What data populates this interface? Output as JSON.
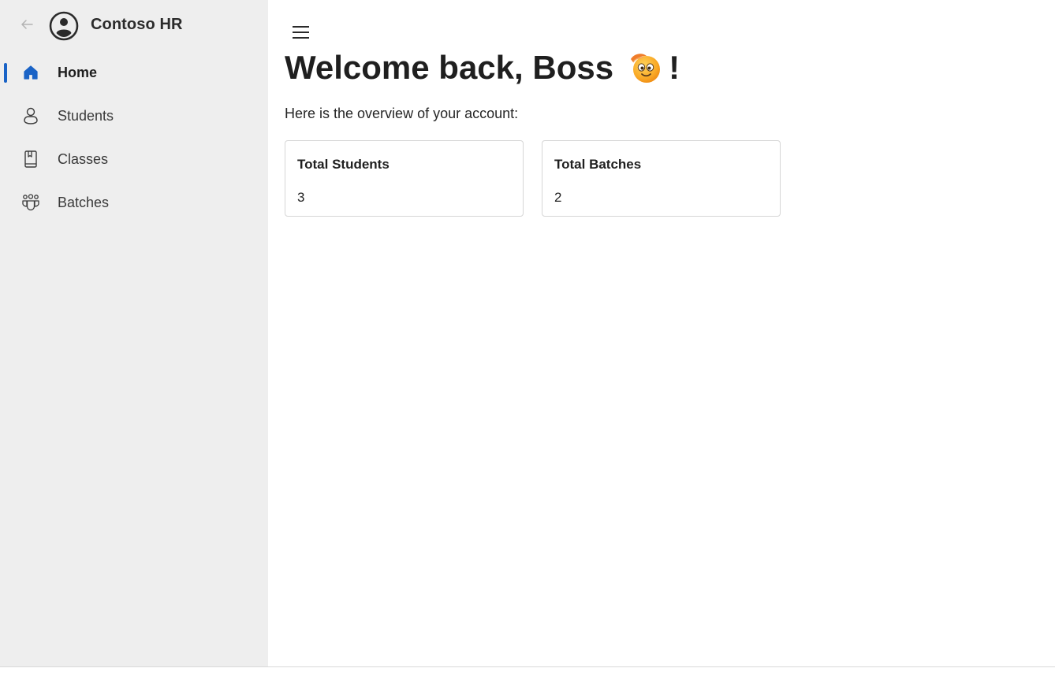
{
  "app": {
    "title": "Contoso HR",
    "accent_color": "#1a63c6"
  },
  "sidebar": {
    "items": [
      {
        "label": "Home",
        "icon": "home-icon",
        "active": true
      },
      {
        "label": "Students",
        "icon": "person-icon",
        "active": false
      },
      {
        "label": "Classes",
        "icon": "book-icon",
        "active": false
      },
      {
        "label": "Batches",
        "icon": "people-team-icon",
        "active": false
      }
    ]
  },
  "main": {
    "welcome_text": "Welcome back, Boss",
    "welcome_suffix": "!",
    "subtitle": "Here is the overview of your account:",
    "cards": [
      {
        "title": "Total Students",
        "value": "3"
      },
      {
        "title": "Total Batches",
        "value": "2"
      }
    ]
  }
}
